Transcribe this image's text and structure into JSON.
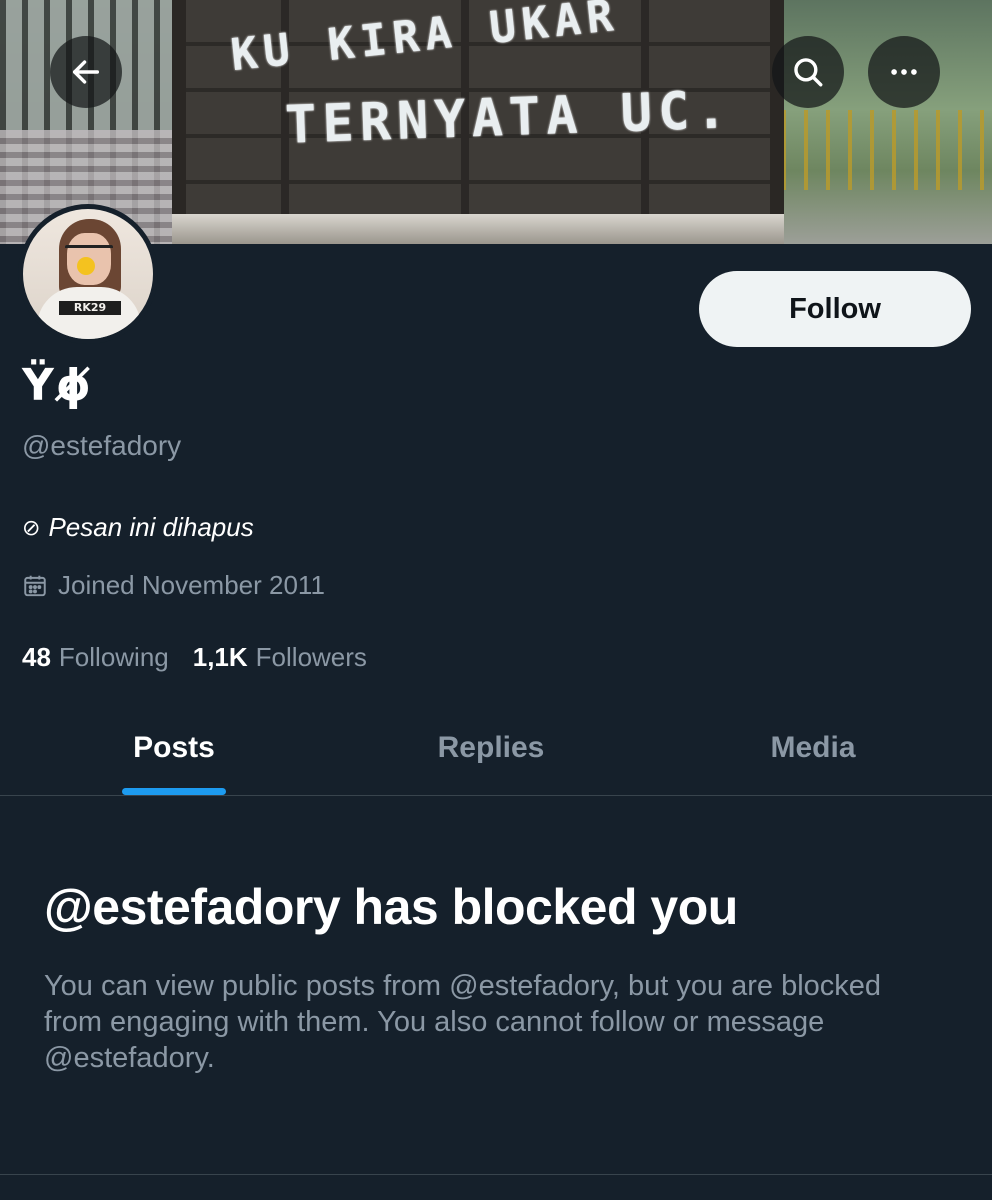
{
  "header": {
    "back_icon": "arrow-left-icon",
    "search_icon": "search-icon",
    "more_icon": "more-horizontal-icon",
    "banner_text_line1": "KU KIRA UKAR",
    "banner_text_line2": "TERNYATA UC."
  },
  "profile": {
    "display_name": "Ÿϕ̸",
    "handle": "@estefadory",
    "bio_icon": "⊘",
    "bio": "Pesan ini dihapus",
    "joined_icon": "calendar-icon",
    "joined": "Joined November 2011",
    "following_count": "48",
    "following_label": "Following",
    "followers_count": "1,1K",
    "followers_label": "Followers",
    "avatar_shirt_text": "RK29"
  },
  "actions": {
    "follow_label": "Follow"
  },
  "tabs": [
    {
      "label": "Posts",
      "active": true
    },
    {
      "label": "Replies",
      "active": false
    },
    {
      "label": "Media",
      "active": false
    }
  ],
  "blocked": {
    "title": "@estefadory has blocked you",
    "description": "You can view public posts from @estefadory, but you are blocked from engaging with them. You also cannot follow or message @estefadory."
  },
  "colors": {
    "background": "#15202b",
    "accent": "#1d9bf0",
    "secondary_text": "#8b98a5",
    "follow_button_bg": "#eff3f4"
  }
}
